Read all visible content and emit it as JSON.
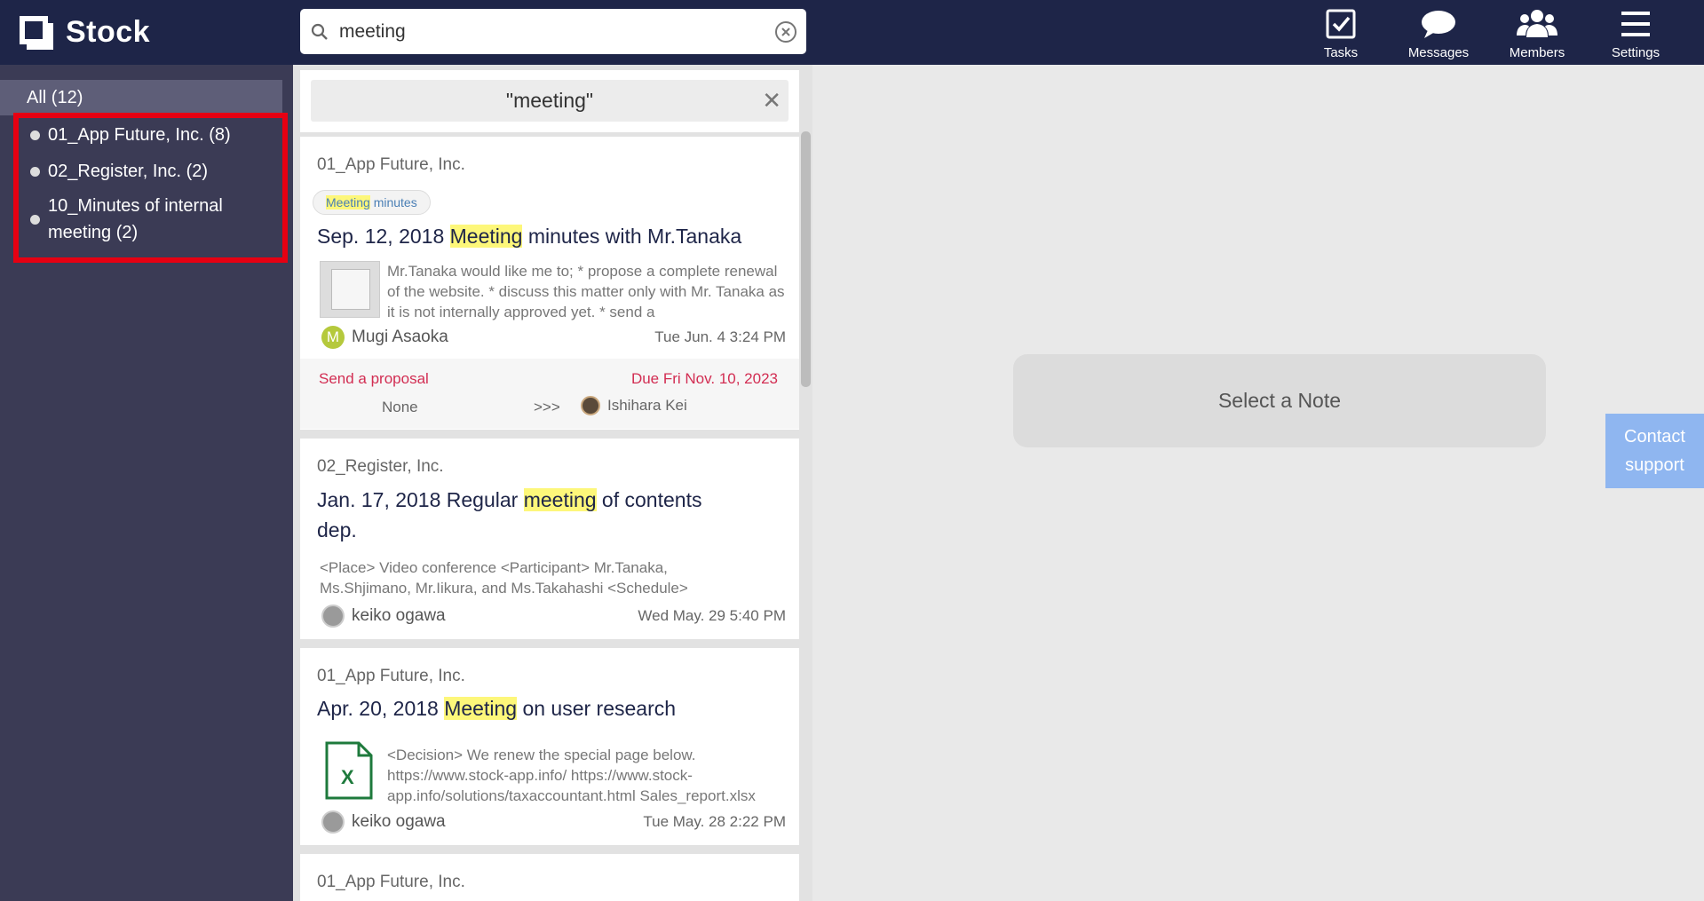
{
  "app": {
    "name": "Stock"
  },
  "search": {
    "value": "meeting",
    "placeholder": ""
  },
  "nav": [
    {
      "label": "Tasks",
      "icon": "checkbox-icon"
    },
    {
      "label": "Messages",
      "icon": "speech-bubble-icon"
    },
    {
      "label": "Members",
      "icon": "people-icon"
    },
    {
      "label": "Settings",
      "icon": "hamburger-icon"
    }
  ],
  "sidebar": {
    "all": "All (12)",
    "folders": [
      {
        "name": "01_App Future, Inc. (8)"
      },
      {
        "name": "02_Register, Inc. (2)"
      },
      {
        "name": "10_Minutes of internal meeting (2)"
      }
    ]
  },
  "filter": {
    "text": "\"meeting\"",
    "close": "✕"
  },
  "notes": [
    {
      "folder": "01_App Future, Inc.",
      "tag_hl": "Meeting",
      "tag_rest": " minutes",
      "title_pre": "Sep. 12, 2018 ",
      "title_hl": "Meeting",
      "title_post": " minutes with Mr.Tanaka",
      "snippet": "Mr.Tanaka would like me to;        * propose a complete renewal of the website. * discuss this matter only with Mr. Tanaka as it is not internally approved yet. * send a",
      "author": "Mugi Asaoka",
      "author_initial": "M",
      "time": "Tue Jun. 4 3:24 PM",
      "task": {
        "label": "Send a proposal",
        "due": "Due  Fri Nov. 10, 2023",
        "from": "None",
        "arrows": ">>>",
        "assignee": "Ishihara Kei"
      }
    },
    {
      "folder": "02_Register, Inc.",
      "title_pre": "Jan. 17, 2018 Regular ",
      "title_hl": "meeting",
      "title_post": " of contents dep.",
      "snippet": "<Place> Video conference <Participant> Mr.Tanaka, Ms.Shjimano, Mr.Iikura, and Ms.Takahashi <Schedule>",
      "author": "keiko ogawa",
      "time": "Wed May. 29 5:40 PM"
    },
    {
      "folder": "01_App Future, Inc.",
      "title_pre": "Apr. 20, 2018 ",
      "title_hl": "Meeting",
      "title_post": " on user research",
      "snippet": "<Decision> We renew the special page below. https://www.stock-app.info/ https://www.stock-app.info/solutions/taxaccountant.html Sales_report.xlsx",
      "author": "keiko ogawa",
      "time": "Tue May. 28 2:22 PM",
      "file_icon_letter": "X"
    },
    {
      "folder": "01_App Future, Inc."
    }
  ],
  "main": {
    "placeholder": "Select a Note"
  },
  "contact": {
    "label": "Contact support"
  },
  "colors": {
    "header": "#1e2548",
    "sidebar": "#3b3b55",
    "highlight": "#fdf77a",
    "task_red": "#d22d52",
    "annotation_red": "#e60012"
  }
}
